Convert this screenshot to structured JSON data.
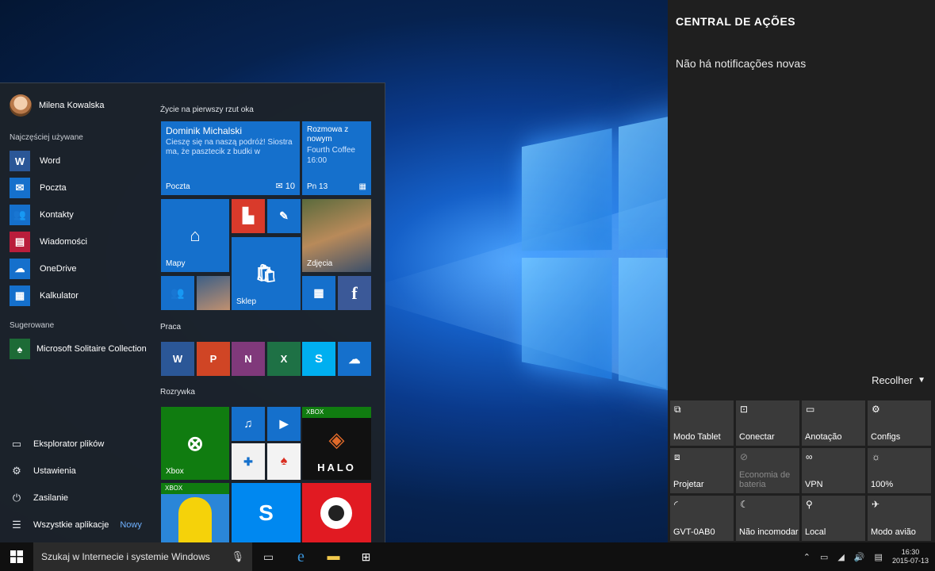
{
  "start_menu": {
    "user_name": "Milena Kowalska",
    "most_used_label": "Najczęściej używane",
    "apps": [
      {
        "name": "Word",
        "icon": "word-icon",
        "color": "#2b5797",
        "glyph": "W"
      },
      {
        "name": "Poczta",
        "icon": "mail-icon",
        "color": "#1570cc",
        "glyph": "✉"
      },
      {
        "name": "Kontakty",
        "icon": "people-icon",
        "color": "#1570cc",
        "glyph": "👥"
      },
      {
        "name": "Wiadomości",
        "icon": "news-icon",
        "color": "#b91d3b",
        "glyph": "▤"
      },
      {
        "name": "OneDrive",
        "icon": "cloud-icon",
        "color": "#1570cc",
        "glyph": "☁"
      },
      {
        "name": "Kalkulator",
        "icon": "calculator-icon",
        "color": "#1570cc",
        "glyph": "▦"
      }
    ],
    "suggested_label": "Sugerowane",
    "suggested_app": "Microsoft Solitaire Collection",
    "bottom": {
      "explorer": "Eksplorator plików",
      "settings": "Ustawienia",
      "power": "Zasilanie",
      "all_apps": "Wszystkie aplikacje",
      "new_badge": "Nowy"
    },
    "groups": {
      "life": "Życie na pierwszy rzut oka",
      "work": "Praca",
      "play": "Rozrywka"
    },
    "tiles": {
      "mail_sender": "Dominik Michalski",
      "mail_preview": "Cieszę się na naszą podróż! Siostra ma, że pasztecik z budki w",
      "mail_app": "Poczta",
      "mail_count": "10",
      "calendar_event": "Rozmowa z nowym",
      "calendar_place": "Fourth Coffee",
      "calendar_time": "16:00",
      "calendar_date": "Pn 13",
      "maps": "Mapy",
      "photos": "Zdjęcia",
      "store": "Sklep",
      "xbox": "Xbox",
      "xbox_badge": "XBOX",
      "halo": "HALO"
    }
  },
  "action_center": {
    "title": "CENTRAL DE AÇÕES",
    "no_notifications": "Não há notificações novas",
    "collapse": "Recolher",
    "quick_actions": [
      {
        "label": "Modo Tablet",
        "icon": "tablet-mode-icon",
        "glyph": "⧉",
        "enabled": true
      },
      {
        "label": "Conectar",
        "icon": "connect-icon",
        "glyph": "⊡",
        "enabled": true
      },
      {
        "label": "Anotação",
        "icon": "note-icon",
        "glyph": "▭",
        "enabled": true
      },
      {
        "label": "Configs",
        "icon": "gear-icon",
        "glyph": "⚙",
        "enabled": true
      },
      {
        "label": "Projetar",
        "icon": "project-icon",
        "glyph": "⧈",
        "enabled": true
      },
      {
        "label": "Economia de bateria",
        "icon": "battery-saver-icon",
        "glyph": "⊘",
        "enabled": false
      },
      {
        "label": "VPN",
        "icon": "vpn-icon",
        "glyph": "∞",
        "enabled": true
      },
      {
        "label": "100%",
        "icon": "brightness-icon",
        "glyph": "☼",
        "enabled": true
      },
      {
        "label": "GVT-0AB0",
        "icon": "wifi-icon",
        "glyph": "◜",
        "enabled": true
      },
      {
        "label": "Não incomodar",
        "icon": "quiet-hours-icon",
        "glyph": "☾",
        "enabled": true
      },
      {
        "label": "Local",
        "icon": "location-icon",
        "glyph": "⚲",
        "enabled": true
      },
      {
        "label": "Modo avião",
        "icon": "airplane-icon",
        "glyph": "✈",
        "enabled": true
      }
    ]
  },
  "taskbar": {
    "search_placeholder": "Szukaj w Internecie i systemie Windows",
    "time": "16:30",
    "date": "2015-07-13"
  }
}
